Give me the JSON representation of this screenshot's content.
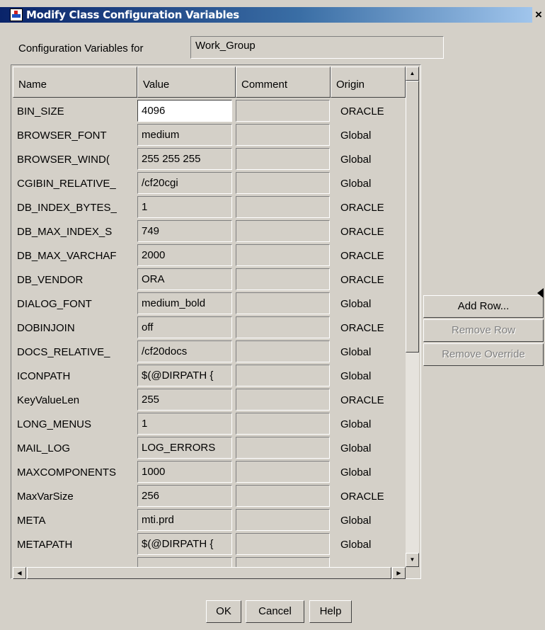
{
  "window": {
    "title": "Modify Class Configuration Variables",
    "close_glyph": "×"
  },
  "config": {
    "label": "Configuration Variables for",
    "class_value": "Work_Group"
  },
  "table": {
    "columns": [
      "Name",
      "Value",
      "Comment",
      "Origin"
    ],
    "rows": [
      {
        "name": "BIN_SIZE",
        "value": "4096",
        "comment": "",
        "origin": "ORACLE",
        "active": true
      },
      {
        "name": "BROWSER_FONT",
        "value": "medium",
        "comment": "",
        "origin": "Global"
      },
      {
        "name": "BROWSER_WIND(",
        "value": "255 255 255",
        "comment": "",
        "origin": "Global"
      },
      {
        "name": "CGIBIN_RELATIVE_",
        "value": "/cf20cgi",
        "comment": "",
        "origin": "Global"
      },
      {
        "name": "DB_INDEX_BYTES_",
        "value": "1",
        "comment": "",
        "origin": "ORACLE"
      },
      {
        "name": "DB_MAX_INDEX_S",
        "value": "749",
        "comment": "",
        "origin": "ORACLE"
      },
      {
        "name": "DB_MAX_VARCHAF",
        "value": "2000",
        "comment": "",
        "origin": "ORACLE"
      },
      {
        "name": "DB_VENDOR",
        "value": "ORA",
        "comment": "",
        "origin": "ORACLE"
      },
      {
        "name": "DIALOG_FONT",
        "value": "medium_bold",
        "comment": "",
        "origin": "Global"
      },
      {
        "name": "DOBINJOIN",
        "value": "off",
        "comment": "",
        "origin": "ORACLE"
      },
      {
        "name": "DOCS_RELATIVE_",
        "value": "/cf20docs",
        "comment": "",
        "origin": "Global"
      },
      {
        "name": "ICONPATH",
        "value": "$(@DIRPATH {",
        "comment": "",
        "origin": "Global"
      },
      {
        "name": "KeyValueLen",
        "value": "255",
        "comment": "",
        "origin": "ORACLE"
      },
      {
        "name": "LONG_MENUS",
        "value": "1",
        "comment": "",
        "origin": "Global"
      },
      {
        "name": "MAIL_LOG",
        "value": "LOG_ERRORS",
        "comment": "",
        "origin": "Global"
      },
      {
        "name": "MAXCOMPONENTS",
        "value": "1000",
        "comment": "",
        "origin": "Global"
      },
      {
        "name": "MaxVarSize",
        "value": "256",
        "comment": "",
        "origin": "ORACLE"
      },
      {
        "name": "META",
        "value": "mti.prd",
        "comment": "",
        "origin": "Global"
      },
      {
        "name": "METAPATH",
        "value": "$(@DIRPATH {",
        "comment": "",
        "origin": "Global"
      },
      {
        "name": "",
        "value": "",
        "comment": "",
        "origin": ""
      }
    ]
  },
  "side_buttons": {
    "add_row": "Add Row...",
    "remove_row": "Remove Row",
    "remove_override": "Remove Override"
  },
  "buttons": {
    "ok": "OK",
    "cancel": "Cancel",
    "help": "Help"
  },
  "scrollbar_glyphs": {
    "up": "▲",
    "down": "▼",
    "left": "◀",
    "right": "▶"
  },
  "colors": {
    "window_bg": "#d4d0c8",
    "title_bar": "#0a246a",
    "active_field": "#ffffff",
    "disabled_text": "#808080"
  }
}
